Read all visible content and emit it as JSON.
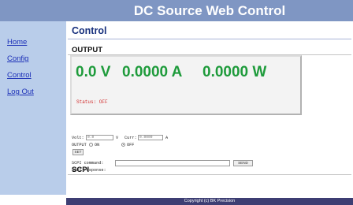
{
  "app": {
    "title": "DC Source Web Control"
  },
  "sidebar": {
    "items": [
      {
        "label": "Home"
      },
      {
        "label": "Config"
      },
      {
        "label": "Control"
      },
      {
        "label": "Log Out"
      }
    ]
  },
  "main": {
    "page_title": "Control",
    "output": {
      "heading": "OUTPUT",
      "voltage": "0.0 V",
      "current": "0.0000 A",
      "power": "0.0000 W",
      "status": "Status: OFF"
    },
    "controls": {
      "volt_label": "Volt:",
      "volt_value": "0.0",
      "volt_unit": "V",
      "curr_label": "Curr:",
      "curr_value": "0.0000",
      "curr_unit": "A",
      "output_label": "OUTPUT",
      "on_label": "ON",
      "off_label": "OFF",
      "output_selected": "OFF",
      "set_button": "SET"
    },
    "scpi": {
      "heading": "SCPI",
      "command_label": "SCPI command:",
      "command_value": "",
      "send_button": "SEND",
      "response_label": "SCPI response:"
    }
  },
  "footer": {
    "text": "Copyright (c) BK Precision"
  },
  "colors": {
    "header_bg": "#7f96c3",
    "sidebar_bg": "#b9cdea",
    "link": "#1d31b8",
    "readout_green": "#1e9b3b",
    "status_red": "#d02a2a",
    "footer_bg": "#3d3e73"
  }
}
